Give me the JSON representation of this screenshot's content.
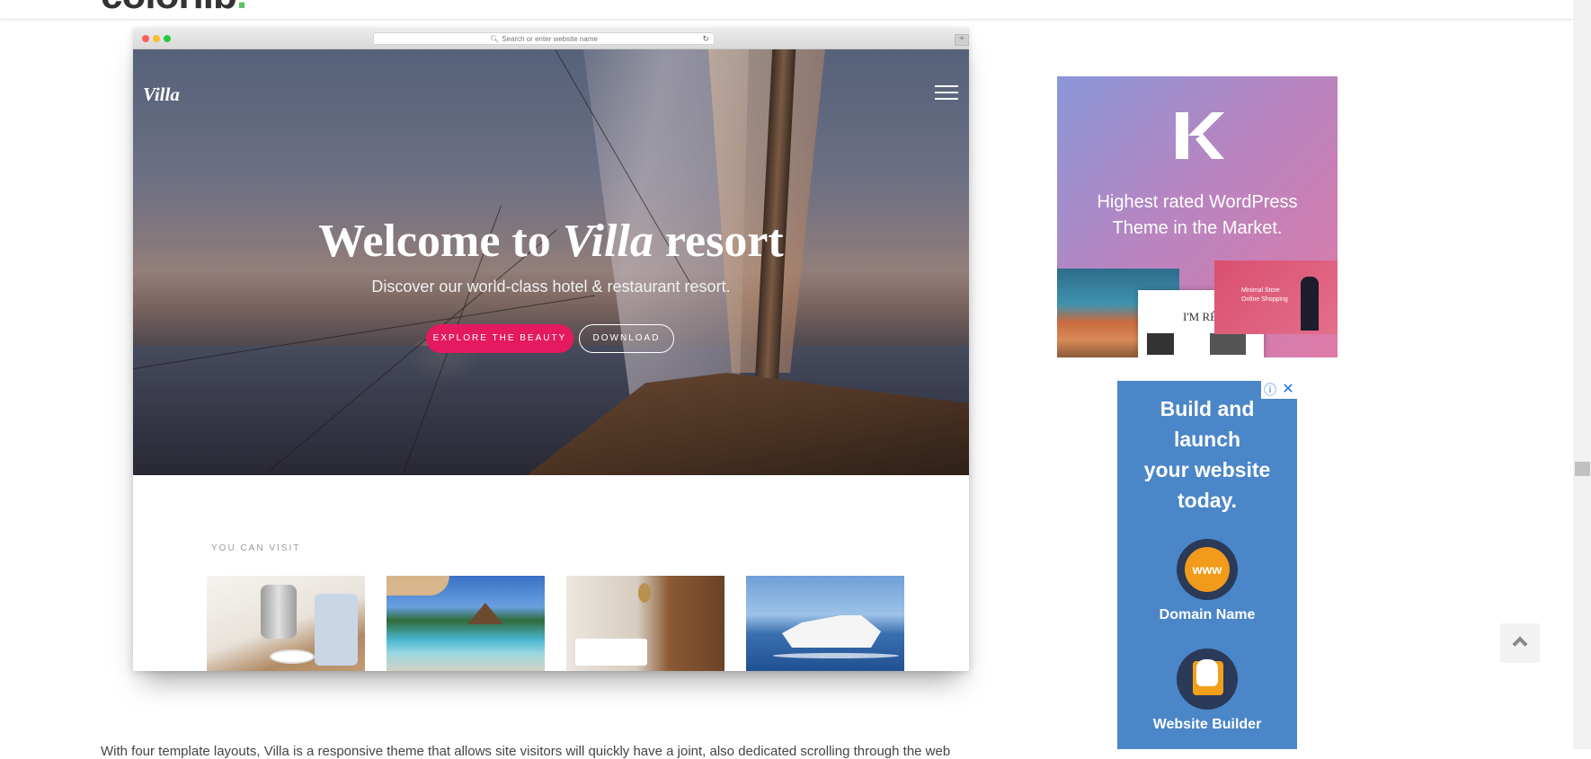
{
  "header": {
    "logo_text": "colorlib",
    "logo_dot": "."
  },
  "mockup": {
    "address_placeholder": "Search or enter website name",
    "hero": {
      "logo": "Villa",
      "title_pre": "Welcome to ",
      "title_italic": "Villa",
      "title_post": " resort",
      "subtitle": "Discover our world-class hotel & restaurant resort.",
      "primary_button": "EXPLORE THE BEAUTY",
      "secondary_button": "DOWNLOAD"
    },
    "section_label": "YOU CAN VISIT"
  },
  "ads": {
    "colorlib": {
      "line1": "Highest rated WordPress",
      "line2": "Theme in the Market.",
      "screenshot_center_title": "I'M RÉM",
      "screenshot_right_text_1": "Minimal Store",
      "screenshot_right_text_2": "Online Shopping"
    },
    "google": {
      "title_lines": [
        "Build and",
        "launch",
        "your website",
        "today."
      ],
      "item1_label": "Domain Name",
      "item1_icon_text": "www",
      "item2_label": "Website Builder"
    }
  },
  "body_text": "With four template layouts, Villa is a responsive theme that allows site visitors will quickly have a joint, also dedicated scrolling through the web",
  "colors": {
    "accent_pink": "#e5195f",
    "logo_dot_green": "#5fc26b",
    "ad_blue": "#4a86c8"
  }
}
